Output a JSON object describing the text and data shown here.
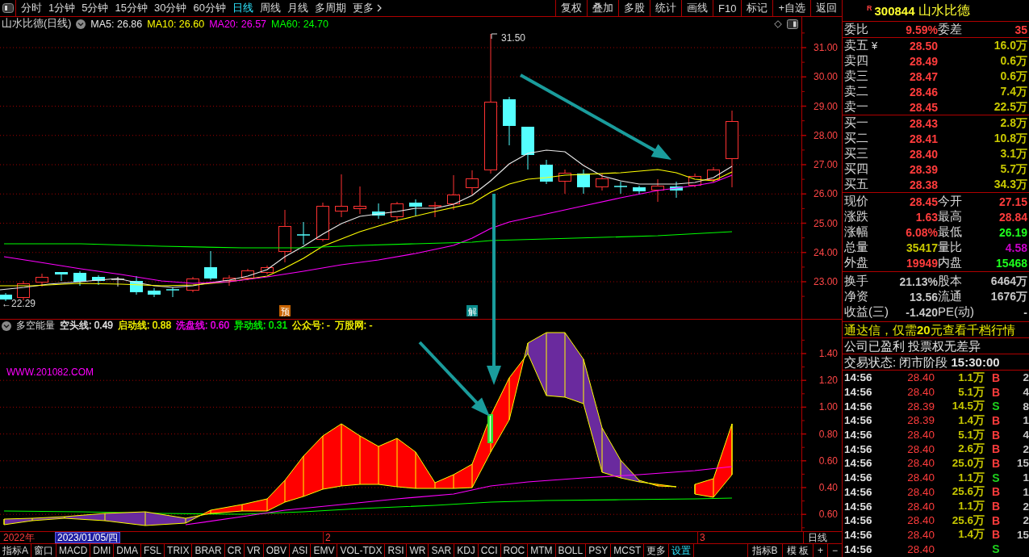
{
  "toolbar": {
    "periods": [
      {
        "label": "分时",
        "kind": "period",
        "selected": false
      },
      {
        "label": "1分钟",
        "kind": "period",
        "selected": false
      },
      {
        "label": "5分钟",
        "kind": "period",
        "selected": false
      },
      {
        "label": "15分钟",
        "kind": "period",
        "selected": false
      },
      {
        "label": "30分钟",
        "kind": "period",
        "selected": false
      },
      {
        "label": "60分钟",
        "kind": "period",
        "selected": false
      },
      {
        "label": "日线",
        "kind": "period",
        "selected": true
      },
      {
        "label": "周线",
        "kind": "period",
        "selected": false
      },
      {
        "label": "月线",
        "kind": "period",
        "selected": false
      },
      {
        "label": "多周期",
        "kind": "period",
        "selected": false
      },
      {
        "label": "更多",
        "kind": "menu",
        "selected": false
      }
    ],
    "actions": [
      "复权",
      "叠加",
      "多股",
      "统计",
      "画线",
      "F10",
      "标记",
      "+自选",
      "返回"
    ]
  },
  "quote_header": {
    "flag": "R",
    "code": "300844",
    "name": "山水比德"
  },
  "price_chart": {
    "title": "山水比德(日线)",
    "averages": [
      {
        "label": "MA5: 26.86",
        "color": "#e8e8e8"
      },
      {
        "label": "MA10: 26.60",
        "color": "#ffff00"
      },
      {
        "label": "MA20: 26.57",
        "color": "#ff00ff"
      },
      {
        "label": "MA60: 24.70",
        "color": "#00ff00"
      }
    ],
    "high_label": "31.50",
    "low_label": "←22.29",
    "event_tags": [
      {
        "text": "预",
        "color": "#c86400"
      },
      {
        "text": "解",
        "color": "#0a8c8c"
      }
    ],
    "axis_labels": [
      "31.00",
      "30.00",
      "29.00",
      "28.00",
      "27.00",
      "26.00",
      "25.00",
      "24.00",
      "23.00"
    ]
  },
  "indicator_chart": {
    "title": "多空能量",
    "legend": [
      {
        "label": "空头线: 0.49",
        "color": "#e8e8e8"
      },
      {
        "label": "启动线: 0.88",
        "color": "#ffff00"
      },
      {
        "label": "洗盘线: 0.60",
        "color": "#ff00ff"
      },
      {
        "label": "异动线: 0.31",
        "color": "#00ff00"
      },
      {
        "label": "公众号: -",
        "color": "#ffff00"
      },
      {
        "label": "万股网: -",
        "color": "#ffff00"
      }
    ],
    "site_label": "WWW.201082.COM",
    "axis_labels": [
      "1.40",
      "1.20",
      "1.00",
      "0.80",
      "0.60",
      "0.40",
      "0.60"
    ]
  },
  "time_axis": {
    "year": "2022年",
    "cursor_date": "2023/01/05/四",
    "months": [
      "2",
      "3"
    ],
    "period": "日线"
  },
  "indicator_tabs": [
    {
      "label": "指标A",
      "kind": "tab"
    },
    {
      "label": "窗口",
      "kind": "tab"
    },
    {
      "label": "MACD",
      "kind": "tab"
    },
    {
      "label": "DMI",
      "kind": "tab"
    },
    {
      "label": "DMA",
      "kind": "tab"
    },
    {
      "label": "FSL",
      "kind": "tab"
    },
    {
      "label": "TRIX",
      "kind": "tab"
    },
    {
      "label": "BRAR",
      "kind": "tab"
    },
    {
      "label": "CR",
      "kind": "tab"
    },
    {
      "label": "VR",
      "kind": "tab"
    },
    {
      "label": "OBV",
      "kind": "tab"
    },
    {
      "label": "ASI",
      "kind": "tab"
    },
    {
      "label": "EMV",
      "kind": "tab"
    },
    {
      "label": "VOL-TDX",
      "kind": "tab"
    },
    {
      "label": "RSI",
      "kind": "tab"
    },
    {
      "label": "WR",
      "kind": "tab"
    },
    {
      "label": "SAR",
      "kind": "tab"
    },
    {
      "label": "KDJ",
      "kind": "tab"
    },
    {
      "label": "CCI",
      "kind": "tab"
    },
    {
      "label": "ROC",
      "kind": "tab"
    },
    {
      "label": "MTM",
      "kind": "tab"
    },
    {
      "label": "BOLL",
      "kind": "tab"
    },
    {
      "label": "PSY",
      "kind": "tab"
    },
    {
      "label": "MCST",
      "kind": "tab"
    },
    {
      "label": "更多",
      "kind": "tab"
    },
    {
      "label": "设置",
      "kind": "settings"
    }
  ],
  "template_buttons": [
    "指标B",
    "模 板",
    "+",
    "−"
  ],
  "order_ratio": [
    {
      "label": "委比",
      "value": "9.59%"
    },
    {
      "label": "委差",
      "value": "35"
    }
  ],
  "asks": [
    {
      "label": "卖五",
      "mark": "¥",
      "price": "28.50",
      "volume": "16.0万"
    },
    {
      "label": "卖四",
      "price": "28.49",
      "volume": "0.6万"
    },
    {
      "label": "卖三",
      "price": "28.47",
      "volume": "0.6万"
    },
    {
      "label": "卖二",
      "price": "28.46",
      "volume": "7.4万"
    },
    {
      "label": "卖一",
      "price": "28.45",
      "volume": "22.5万"
    }
  ],
  "bids": [
    {
      "label": "买一",
      "price": "28.43",
      "volume": "2.8万"
    },
    {
      "label": "买二",
      "price": "28.41",
      "volume": "10.8万"
    },
    {
      "label": "买三",
      "price": "28.40",
      "volume": "3.1万"
    },
    {
      "label": "买四",
      "price": "28.39",
      "volume": "5.7万"
    },
    {
      "label": "买五",
      "price": "28.38",
      "volume": "34.3万"
    }
  ],
  "stats": [
    {
      "label": "现价",
      "value": "28.45",
      "color": "#ff3c3c"
    },
    {
      "label": "今开",
      "value": "27.15",
      "color": "#ff3c3c"
    },
    {
      "label": "涨跌",
      "value": "1.63",
      "color": "#ff3c3c"
    },
    {
      "label": "最高",
      "value": "28.84",
      "color": "#ff3c3c"
    },
    {
      "label": "涨幅",
      "value": "6.08%",
      "color": "#ff3c3c"
    },
    {
      "label": "最低",
      "value": "26.19",
      "color": "#1eff1e"
    },
    {
      "label": "总量",
      "value": "35417",
      "color": "#c8c800"
    },
    {
      "label": "量比",
      "value": "4.58",
      "color": "#c800c8"
    },
    {
      "label": "外盘",
      "value": "19949",
      "color": "#ff3c3c"
    },
    {
      "label": "内盘",
      "value": "15468",
      "color": "#1eff1e"
    }
  ],
  "fundamentals": [
    {
      "label": "换手",
      "value": "21.13%"
    },
    {
      "label": "股本",
      "value": "6464万"
    },
    {
      "label": "净资",
      "value": "13.56"
    },
    {
      "label": "流通",
      "value": "1676万"
    },
    {
      "label": "收益(三)",
      "value": "-1.420"
    },
    {
      "label": "PE(动)",
      "value": "-"
    }
  ],
  "notices": [
    {
      "text": "通达信，仅需**20**元查看千档行情",
      "kind": "promo"
    },
    {
      "text": "公司已盈利 投票权无差异",
      "kind": "info"
    },
    {
      "text": "交易状态: 闭市阶段 **15:30:00**",
      "kind": "info"
    }
  ],
  "ticks": [
    {
      "time": "14:56",
      "price": "28.40",
      "volume": "1.1万",
      "side": "B",
      "color": "#ff3c3c",
      "count": "2"
    },
    {
      "time": "14:56",
      "price": "28.40",
      "volume": "5.1万",
      "side": "B",
      "color": "#ff3c3c",
      "count": "4"
    },
    {
      "time": "14:56",
      "price": "28.39",
      "volume": "14.5万",
      "side": "S",
      "color": "#1ed21e",
      "count": "8"
    },
    {
      "time": "14:56",
      "price": "28.39",
      "volume": "1.4万",
      "side": "B",
      "color": "#ff3c3c",
      "count": "1"
    },
    {
      "time": "14:56",
      "price": "28.40",
      "volume": "5.1万",
      "side": "B",
      "color": "#ff3c3c",
      "count": "4"
    },
    {
      "time": "14:56",
      "price": "28.40",
      "volume": "2.6万",
      "side": "B",
      "color": "#ff3c3c",
      "count": "2"
    },
    {
      "time": "14:56",
      "price": "28.40",
      "volume": "25.0万",
      "side": "B",
      "color": "#ff3c3c",
      "count": "15"
    },
    {
      "time": "14:56",
      "price": "28.40",
      "volume": "1.1万",
      "side": "S",
      "color": "#1ed21e",
      "count": "1"
    },
    {
      "time": "14:56",
      "price": "28.40",
      "volume": "25.6万",
      "side": "B",
      "color": "#ff3c3c",
      "count": "1"
    },
    {
      "time": "14:56",
      "price": "28.40",
      "volume": "1.1万",
      "side": "B",
      "color": "#ff3c3c",
      "count": "2"
    },
    {
      "time": "14:56",
      "price": "28.40",
      "volume": "25.6万",
      "side": "B",
      "color": "#ff3c3c",
      "count": "2"
    },
    {
      "time": "14:56",
      "price": "28.40",
      "volume": "1.4万",
      "side": "B",
      "color": "#ff3c3c",
      "count": "15"
    },
    {
      "time": "14:56",
      "price": "28.40",
      "side": "S",
      "color": "#1ed21e"
    }
  ]
}
